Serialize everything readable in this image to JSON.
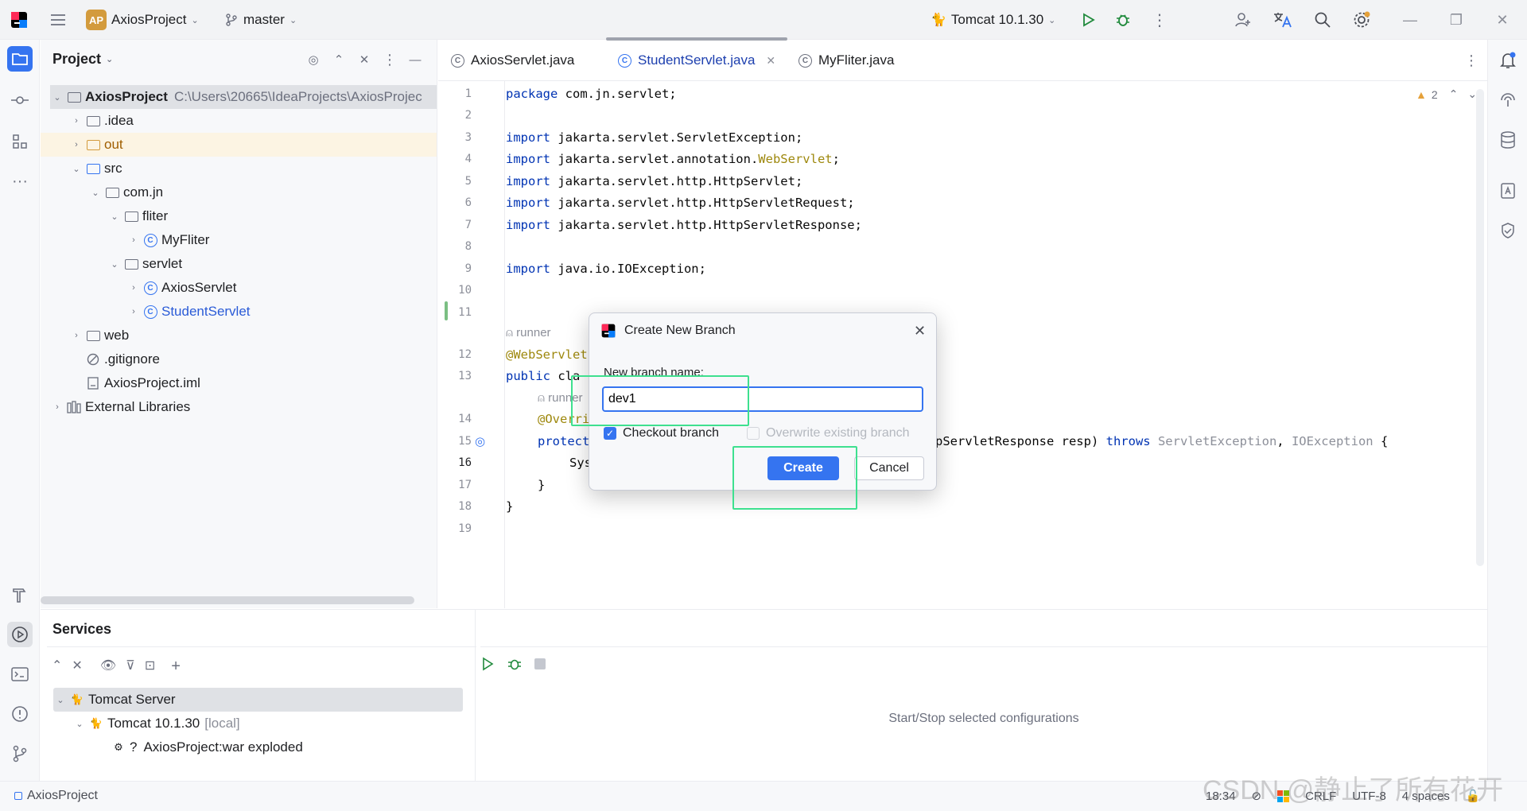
{
  "titlebar": {
    "project_badge": "AP",
    "project_name": "AxiosProject",
    "branch": "master",
    "run_config": "Tomcat 10.1.30"
  },
  "project_panel": {
    "title": "Project",
    "tree": [
      {
        "label": "AxiosProject",
        "path": "C:\\Users\\20665\\IdeaProjects\\AxiosProjec"
      },
      {
        "label": ".idea"
      },
      {
        "label": "out"
      },
      {
        "label": "src"
      },
      {
        "label": "com.jn"
      },
      {
        "label": "fliter"
      },
      {
        "label": "MyFliter"
      },
      {
        "label": "servlet"
      },
      {
        "label": "AxiosServlet"
      },
      {
        "label": "StudentServlet"
      },
      {
        "label": "web"
      },
      {
        "label": ".gitignore"
      },
      {
        "label": "AxiosProject.iml"
      },
      {
        "label": "External Libraries"
      }
    ]
  },
  "editor": {
    "tabs": [
      {
        "label": "AxiosServlet.java"
      },
      {
        "label": "StudentServlet.java"
      },
      {
        "label": "MyFliter.java"
      }
    ],
    "warning_count": "2",
    "line_numbers": [
      "1",
      "2",
      "3",
      "4",
      "5",
      "6",
      "7",
      "8",
      "9",
      "10",
      "11",
      "12",
      "13",
      "14",
      "15",
      "16",
      "17",
      "18",
      "19"
    ],
    "code": {
      "l1_kw": "package",
      "l1_rest": " com.jn.servlet;",
      "import_kw": "import",
      "l3": " jakarta.servlet.ServletException;",
      "l4a": " jakarta.servlet.annotation.",
      "l4b": "WebServlet",
      "l4c": ";",
      "l5": " jakarta.servlet.http.HttpServlet;",
      "l6": " jakarta.servlet.http.HttpServletRequest;",
      "l7": " jakarta.servlet.http.HttpServletResponse;",
      "l9": " java.io.IOException;",
      "hint_runner": "runner",
      "l12": "@WebServlet",
      "l13_kw": "public",
      "l13_rest": " cla",
      "l14": "@Overri",
      "l15_kw": "protect",
      "l15_tail_a": "pServletResponse resp) ",
      "l15_throws": "throws",
      "l15_tail_b": " ServletException",
      "l15_tail_c": ", ",
      "l15_tail_d": "IOException",
      "l15_tail_e": " {",
      "l16": "Sys",
      "l17": "}",
      "l18": "}"
    }
  },
  "dialog": {
    "title": "Create New Branch",
    "field_label": "New branch name:",
    "field_value": "dev1",
    "checkout_label": "Checkout branch",
    "overwrite_label": "Overwrite existing branch",
    "create_label": "Create",
    "cancel_label": "Cancel"
  },
  "services": {
    "title": "Services",
    "tree": [
      {
        "label": "Tomcat Server"
      },
      {
        "label": "Tomcat 10.1.30",
        "suffix": "[local]"
      },
      {
        "label": "AxiosProject:war exploded",
        "prefix": "?"
      }
    ],
    "empty_text": "Start/Stop selected configurations"
  },
  "statusbar": {
    "breadcrumb": "AxiosProject",
    "position": "18:34",
    "line_sep": "CRLF",
    "encoding": "UTF-8",
    "indent": "4 spaces"
  },
  "watermark": "CSDN @静止了所有花开",
  "colors": {
    "accent": "#3574f0",
    "highlight_box": "#3ee08f"
  }
}
